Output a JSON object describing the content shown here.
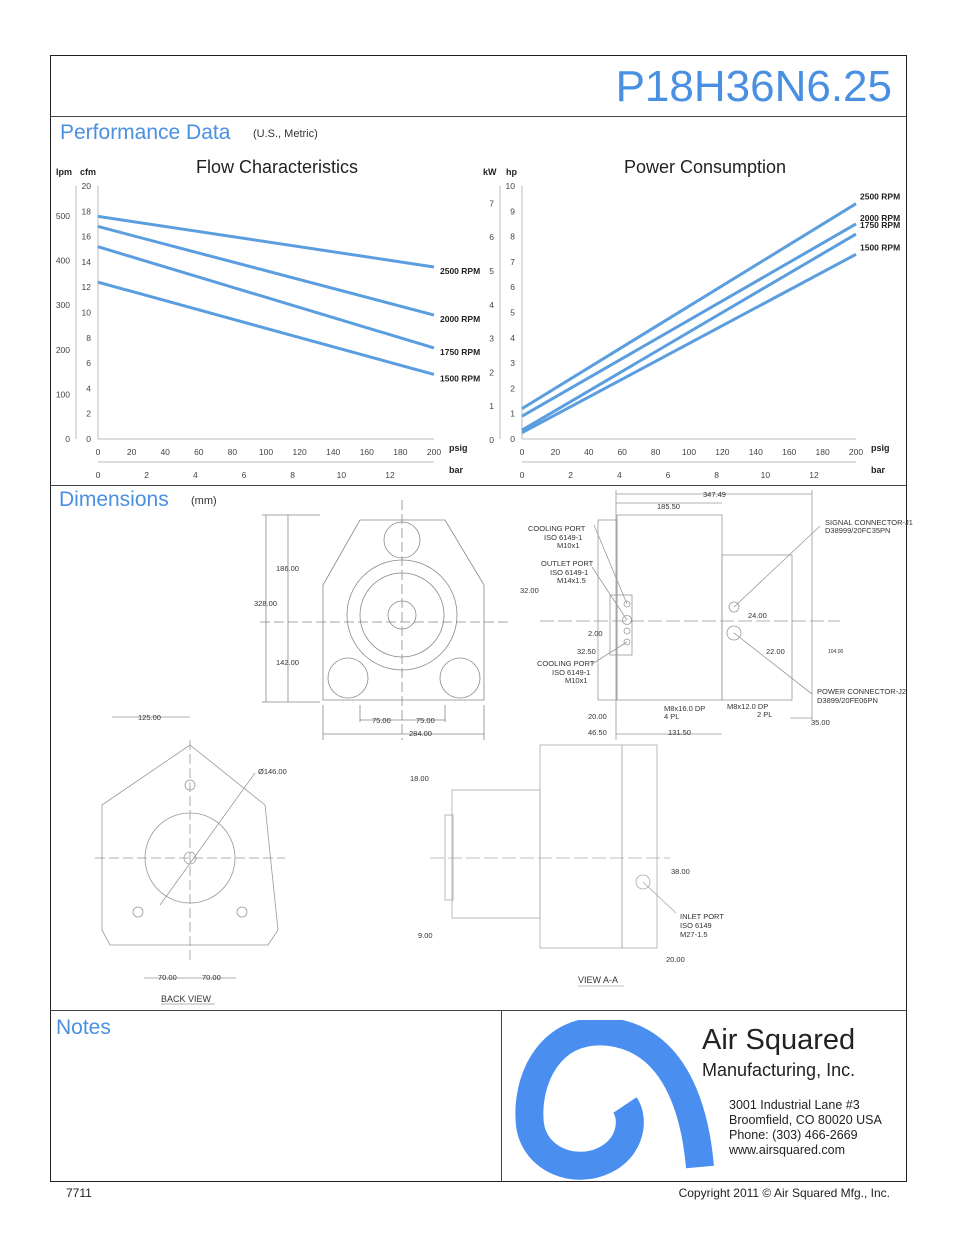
{
  "header": {
    "model": "P18H36N6.25"
  },
  "performance": {
    "title": "Performance Data",
    "units": "(U.S., Metric)"
  },
  "dimensions": {
    "title": "Dimensions",
    "units": "(mm)",
    "labels": {
      "d347": "347.49",
      "d185": "185.50",
      "d186": "186.00",
      "d328": "328.00",
      "d142": "142.00",
      "d75a": "75.00",
      "d75b": "75.00",
      "d284": "284.00",
      "d32": "32.00",
      "d2": "2.00",
      "d325": "32.50",
      "d24": "24.00",
      "d22": "22.00",
      "d104": "104.00",
      "d20a": "20.00",
      "d465": "46.50",
      "d1315": "131.50",
      "d35": "35.00",
      "cool1": [
        "COOLING PORT",
        "ISO 6149-1",
        "M10x1"
      ],
      "outlet": [
        "OUTLET PORT",
        "ISO 6149-1",
        "M14x1.5"
      ],
      "cool2": [
        "COOLING PORT",
        "ISO 6149-1",
        "M10x1"
      ],
      "signal": [
        "SIGNAL CONNECTOR-J1",
        "D38999/20FC35PN"
      ],
      "power": [
        "POWER CONNECTOR-J2",
        "D3899/20FE06PN"
      ],
      "m816": [
        "M8x16.0 DP",
        "4 PL"
      ],
      "m812": [
        "M8x12.0 DP",
        "2 PL"
      ],
      "d125": "125.00",
      "d146": "Ø146.00",
      "d70a": "70.00",
      "d70b": "70.00",
      "back_view": "BACK VIEW",
      "d18": "18.00",
      "d9": "9.00",
      "d38": "38.00",
      "d20b": "20.00",
      "inlet": [
        "INLET PORT",
        "ISO 6149",
        "M27-1.5"
      ],
      "view_aa": "VIEW A-A"
    }
  },
  "notes": {
    "title": "Notes"
  },
  "company": {
    "name": "Air Squared",
    "sub": "Manufacturing, Inc.",
    "address": "3001 Industrial Lane #3",
    "city": "Broomfield, CO 80020 USA",
    "phone": "Phone: (303) 466-2669",
    "web": "www.airsquared.com",
    "logo_color": "#4a8ff0"
  },
  "footer": {
    "doc_number": "7711",
    "copyright": "Copyright 2011 © Air Squared Mfg., Inc."
  },
  "chart_data": [
    {
      "type": "line",
      "title": "Flow Characteristics",
      "xlabel": "psig",
      "x2label": "bar",
      "ylabel": "cfm",
      "y2label": "lpm",
      "xlim": [
        0,
        200
      ],
      "xticks": [
        0,
        20,
        40,
        60,
        80,
        100,
        120,
        140,
        160,
        180,
        200
      ],
      "x2ticks": [
        0,
        2,
        4,
        6,
        8,
        10,
        12
      ],
      "ylim": [
        0,
        20
      ],
      "yticks": [
        0,
        2,
        4,
        6,
        8,
        10,
        12,
        14,
        16,
        18,
        20
      ],
      "y2ticks": [
        0,
        100,
        200,
        300,
        400,
        500
      ],
      "line_color": "#5b9ee0",
      "series": [
        {
          "name": "2500 RPM",
          "x": [
            0,
            200
          ],
          "values": [
            17.6,
            13.6
          ]
        },
        {
          "name": "2000 RPM",
          "x": [
            0,
            200
          ],
          "values": [
            16.8,
            9.8
          ]
        },
        {
          "name": "1750 RPM",
          "x": [
            0,
            200
          ],
          "values": [
            15.2,
            7.2
          ]
        },
        {
          "name": "1500 RPM",
          "x": [
            0,
            200
          ],
          "values": [
            12.4,
            5.1
          ]
        }
      ]
    },
    {
      "type": "line",
      "title": "Power Consumption",
      "xlabel": "psig",
      "x2label": "bar",
      "ylabel": "hp",
      "y2label": "kW",
      "xlim": [
        0,
        200
      ],
      "xticks": [
        0,
        20,
        40,
        60,
        80,
        100,
        120,
        140,
        160,
        180,
        200
      ],
      "x2ticks": [
        0,
        2,
        4,
        6,
        8,
        10,
        12
      ],
      "ylim": [
        0,
        10
      ],
      "yticks": [
        0,
        1,
        2,
        3,
        4,
        5,
        6,
        7,
        8,
        9,
        10
      ],
      "y2ticks": [
        0,
        1,
        2,
        3,
        4,
        5,
        6,
        7
      ],
      "line_color": "#5b9ee0",
      "series": [
        {
          "name": "2500 RPM",
          "x": [
            0,
            200
          ],
          "values": [
            1.2,
            9.3
          ]
        },
        {
          "name": "2000 RPM",
          "x": [
            0,
            200
          ],
          "values": [
            0.9,
            8.5
          ]
        },
        {
          "name": "1750 RPM",
          "x": [
            0,
            200
          ],
          "values": [
            0.35,
            8.1
          ]
        },
        {
          "name": "1500 RPM",
          "x": [
            0,
            200
          ],
          "values": [
            0.25,
            7.3
          ]
        }
      ]
    }
  ]
}
